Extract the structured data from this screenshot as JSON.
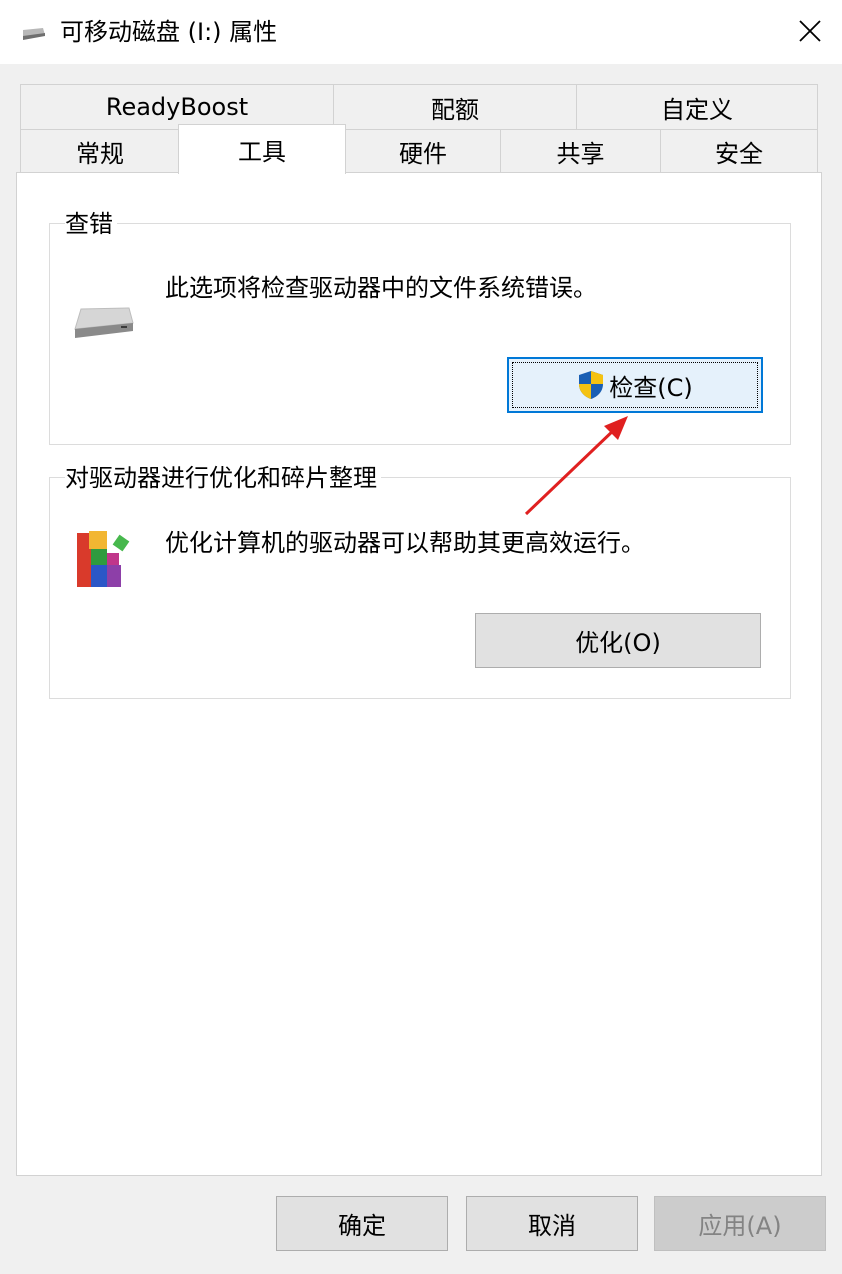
{
  "window": {
    "title": "可移动磁盘 (I:) 属性",
    "close_glyph": "✕"
  },
  "tabs": {
    "row1": [
      "ReadyBoost",
      "配额",
      "自定义"
    ],
    "row2": [
      "常规",
      "工具",
      "硬件",
      "共享",
      "安全"
    ],
    "active": "工具"
  },
  "error_check": {
    "group_label": "查错",
    "description": "此选项将检查驱动器中的文件系统错误。",
    "button_label": "检查(C)",
    "button_icon": "uac-shield-icon"
  },
  "optimize": {
    "group_label": "对驱动器进行优化和碎片整理",
    "description": "优化计算机的驱动器可以帮助其更高效运行。",
    "button_label": "优化(O)"
  },
  "footer": {
    "ok_label": "确定",
    "cancel_label": "取消",
    "apply_label": "应用(A)"
  },
  "colors": {
    "focus_blue": "#0078d7",
    "annotation_red": "#e02020"
  }
}
